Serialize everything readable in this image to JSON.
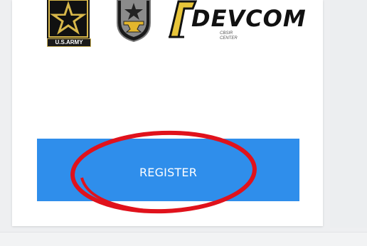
{
  "logos": {
    "army_text": "U.S.ARMY",
    "devcom_text": "DEVCOM",
    "devcom_sub_line1": "CBSIR",
    "devcom_sub_line2": "CENTER",
    "army_icon": "us-army-star-logo",
    "anvil_icon": "anvil-insignia",
    "colors": {
      "army_gold": "#d8b84a",
      "army_black": "#111111",
      "devcom_gold": "#e8c53a"
    }
  },
  "register": {
    "label": "REGISTER",
    "background": "#2f8eeb",
    "text_color": "#ffffff"
  },
  "annotation": {
    "shape": "ellipse",
    "color": "#e0121c"
  }
}
